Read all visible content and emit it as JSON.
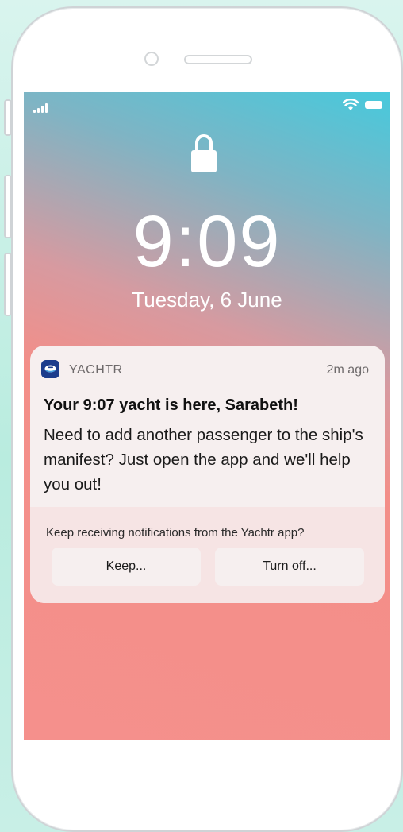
{
  "status_bar": {
    "signal_icon": "cellular-signal-icon",
    "wifi_icon": "wifi-icon",
    "battery_icon": "battery-icon"
  },
  "lock_screen": {
    "lock_icon": "padlock-icon",
    "time": "9:09",
    "date": "Tuesday, 6 June"
  },
  "notification": {
    "app_icon": "yacht-app-icon",
    "app_name": "YACHTR",
    "timestamp": "2m ago",
    "title": "Your 9:07 yacht is here, Sarabeth!",
    "body": "Need to add another passenger to the ship's manifest? Just open the app and we'll help you out!",
    "prompt": "Keep receiving notifications from the Yachtr app?",
    "actions": {
      "keep": "Keep...",
      "turn_off": "Turn off..."
    }
  },
  "colors": {
    "screen_top": "#47c9dc",
    "screen_bottom": "#f5908c",
    "app_icon_bg": "#1c3c8c"
  }
}
